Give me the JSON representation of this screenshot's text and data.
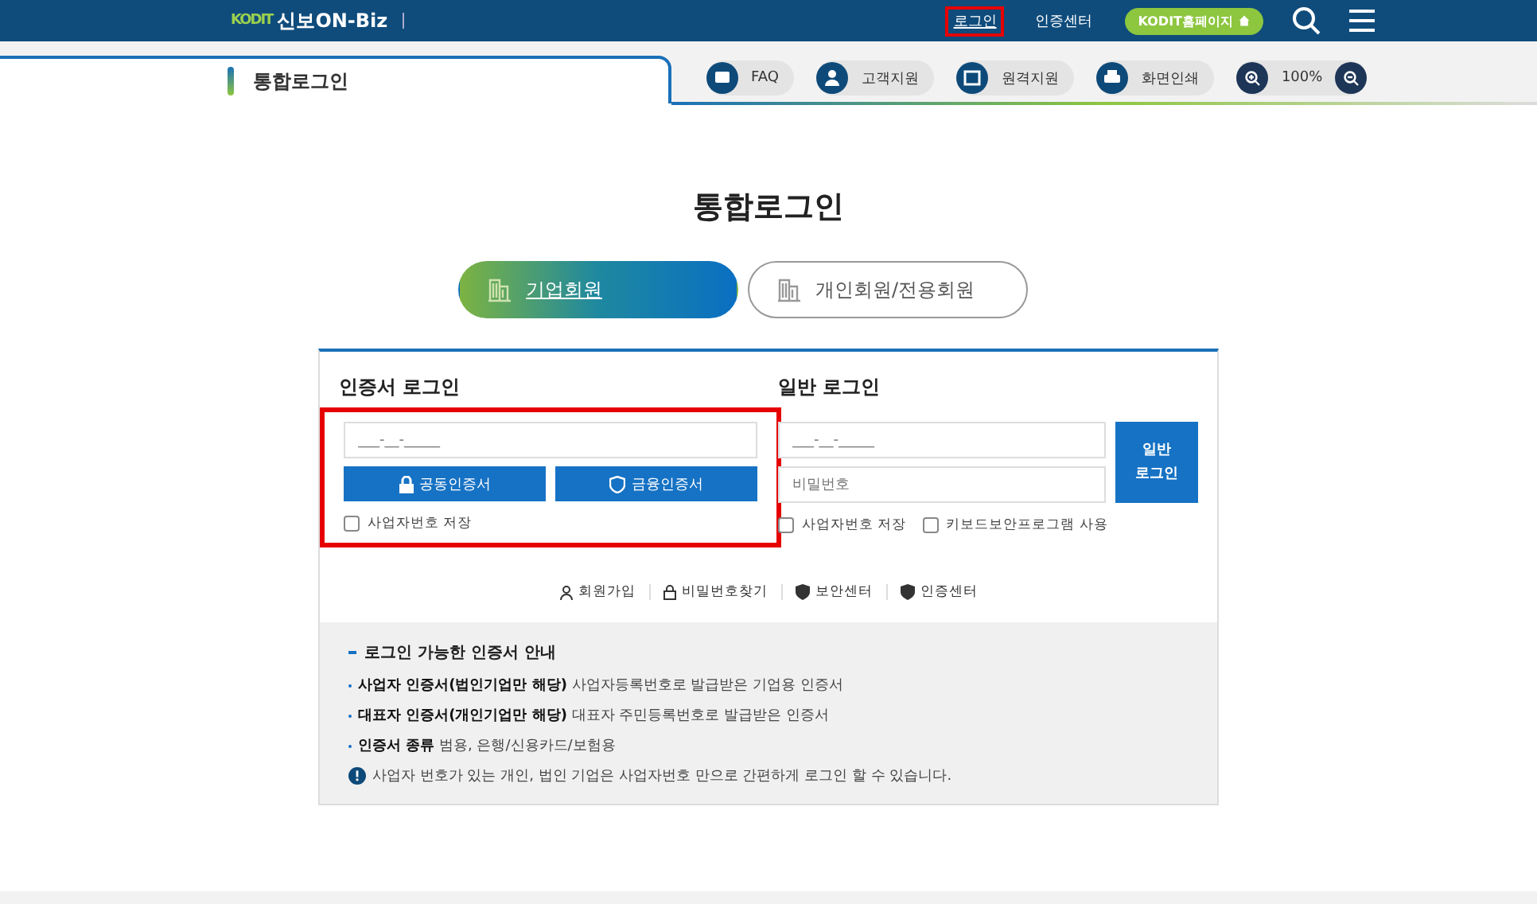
{
  "header": {
    "logo_mark": "KODIT",
    "logo_text": "신보ON-Biz",
    "links": [
      {
        "label": "로그인",
        "highlighted": true
      },
      {
        "label": "인증센터",
        "highlighted": false
      }
    ],
    "home_button": "KODIT홈페이지"
  },
  "subheader": {
    "page_tab": "통합로그인",
    "tools": [
      {
        "kind": "faq",
        "label": "FAQ"
      },
      {
        "kind": "support",
        "label": "고객지원"
      },
      {
        "kind": "remote",
        "label": "원격지원"
      },
      {
        "kind": "print",
        "label": "화면인쇄"
      }
    ],
    "zoom": "100%"
  },
  "title": "통합로그인",
  "member_tabs": [
    {
      "label": "기업회원",
      "selected": true
    },
    {
      "label": "개인회원/전용회원",
      "selected": false
    }
  ],
  "cert_login": {
    "heading": "인증서 로그인",
    "highlighted": true,
    "field": {
      "placeholder": "___-__-_____"
    },
    "buttons": [
      {
        "kind": "lock",
        "label": "공동인증서"
      },
      {
        "kind": "shield",
        "label": "금융인증서"
      }
    ],
    "checkboxes": [
      {
        "label": "사업자번호 저장",
        "checked": false
      }
    ]
  },
  "general_login": {
    "heading": "일반 로그인",
    "id_field": {
      "placeholder": "___-__-_____"
    },
    "password_field": {
      "placeholder": "비밀번호"
    },
    "button": "일반\n로그인",
    "checkboxes": [
      {
        "label": "사업자번호 저장",
        "checked": false
      },
      {
        "label": "키보드보안프로그램 사용",
        "checked": false
      }
    ]
  },
  "links": [
    {
      "kind": "person",
      "label": "회원가입"
    },
    {
      "kind": "lock",
      "label": "비밀번호찾기"
    },
    {
      "kind": "shield",
      "label": "보안센터"
    },
    {
      "kind": "shield",
      "label": "인증센터"
    }
  ],
  "guide": {
    "heading": "로그인 가능한 인증서 안내",
    "items": [
      "**사업자 인증서(법인기업만 해당)** 사업자등록번호로 발급받은 기업용 인증서",
      "**대표자 인증서(개인기업만 해당)** 대표자 주민등록번호로 발급받은 인증서",
      "**인증서 종류** 범용, 은행/신용카드/보험용"
    ],
    "note": "사업자 번호가 있는 개인, 법인 기업은 사업자번호 만으로 간편하게 로그인 할 수 있습니다."
  }
}
